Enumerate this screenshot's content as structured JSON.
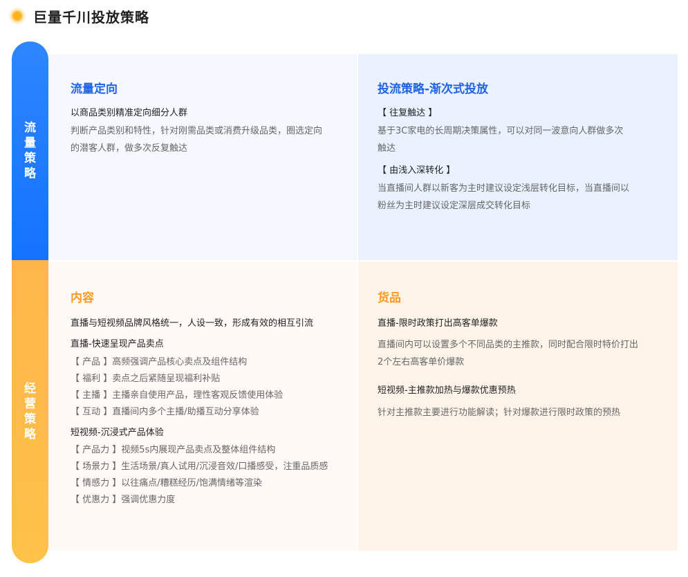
{
  "header": {
    "title": "巨量千川投放策略",
    "icon": "sun-icon"
  },
  "side": {
    "traffic_label": "流量策略",
    "ops_label": "经营策略",
    "colors": {
      "traffic": "#1472ff",
      "ops": "#ffb54a"
    }
  },
  "traffic_targeting": {
    "title": "流量定向",
    "subtitle": "以商品类别精准定向细分人群",
    "desc_lines": [
      "判断产品类别和特性，针对刚需品类或消费升级品类，圈选定向",
      "的潜客人群，做多次反复触达"
    ]
  },
  "traffic_strategy": {
    "title": "投流策略-渐次式投放",
    "blocks": [
      {
        "label": "【 往复触达 】",
        "lines": [
          "基于3C家电的长周期决策属性，可以对同一波意向人群做多次",
          "触达"
        ]
      },
      {
        "label": "【 由浅入深转化 】",
        "lines": [
          "当直播间人群以新客为主时建议设定浅层转化目标，当直播间以",
          "粉丝为主时建议设定深层成交转化目标"
        ]
      }
    ]
  },
  "content": {
    "title": "内容",
    "intro": "直播与短视频品牌风格统一，人设一致，形成有效的相互引流",
    "groups": [
      {
        "heading": "直播-快速呈现产品卖点",
        "items": [
          "【 产品 】高频强调产品核心卖点及组件结构",
          "【 福利 】卖点之后紧随呈现福利补贴",
          "【 主播 】主播亲自使用产品，理性客观反馈使用体验",
          "【 互动 】直播间内多个主播/助播互动分享体验"
        ]
      },
      {
        "heading": "短视频-沉浸式产品体验",
        "items": [
          "【 产品力 】视频5s内展现产品卖点及整体组件结构",
          "【 场景力 】生活场景/真人试用/沉浸音效/口播感受，注重品质感",
          "【 情感力 】以往痛点/糟糕经历/饱满情绪等渲染",
          "【 优惠力 】强调优惠力度"
        ]
      }
    ]
  },
  "goods": {
    "title": "货品",
    "blocks": [
      {
        "heading": "直播-限时政策打出高客单爆款",
        "lines": [
          "直播间内可以设置多个不同品类的主推款，同时配合限时特价打出",
          "2个左右高客单价爆款"
        ]
      },
      {
        "heading": "短视频-主推款加热与爆款优惠预热",
        "lines": [
          "针对主推款主要进行功能解读；针对爆款进行限时政策的预热"
        ]
      }
    ]
  }
}
